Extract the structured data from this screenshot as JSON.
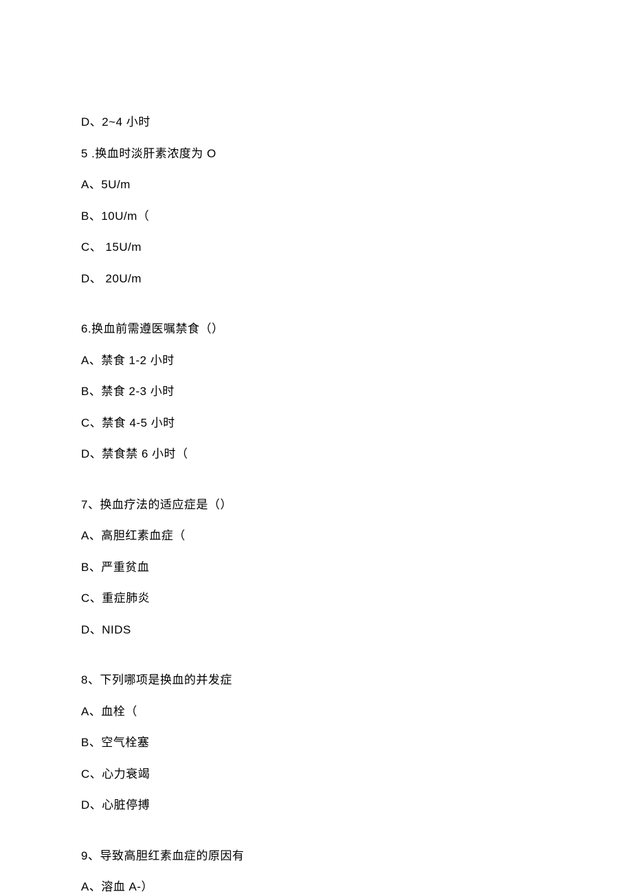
{
  "lines": [
    {
      "text": "D、2~4 小时",
      "gap": false
    },
    {
      "text": "5  .换血时淡肝素浓度为 O",
      "gap": false
    },
    {
      "text": "A、5U/m",
      "gap": false
    },
    {
      "text": "B、10U/m（",
      "gap": false
    },
    {
      "text": "C、 15U/m",
      "gap": false
    },
    {
      "text": "D、 20U/m",
      "gap": true
    },
    {
      "text": "6.换血前需遵医嘱禁食（）",
      "gap": false
    },
    {
      "text": "A、禁食 1-2 小时",
      "gap": false
    },
    {
      "text": "B、禁食 2-3 小时",
      "gap": false
    },
    {
      "text": "C、禁食 4-5 小时",
      "gap": false
    },
    {
      "text": "D、禁食禁 6 小时（",
      "gap": true
    },
    {
      "text": "7、换血疗法的适应症是（）",
      "gap": false
    },
    {
      "text": "A、高胆红素血症（",
      "gap": false
    },
    {
      "text": "B、严重贫血",
      "gap": false
    },
    {
      "text": "C、重症肺炎",
      "gap": false
    },
    {
      "text": "D、NIDS",
      "gap": true
    },
    {
      "text": "8、下列哪项是换血的并发症",
      "gap": false
    },
    {
      "text": "A、血栓（",
      "gap": false
    },
    {
      "text": "B、空气栓塞",
      "gap": false
    },
    {
      "text": "C、心力衰竭",
      "gap": false
    },
    {
      "text": "D、心脏停搏",
      "gap": true
    },
    {
      "text": "9、导致高胆红素血症的原因有",
      "gap": false
    },
    {
      "text": "A、溶血 A-）",
      "gap": false
    }
  ]
}
